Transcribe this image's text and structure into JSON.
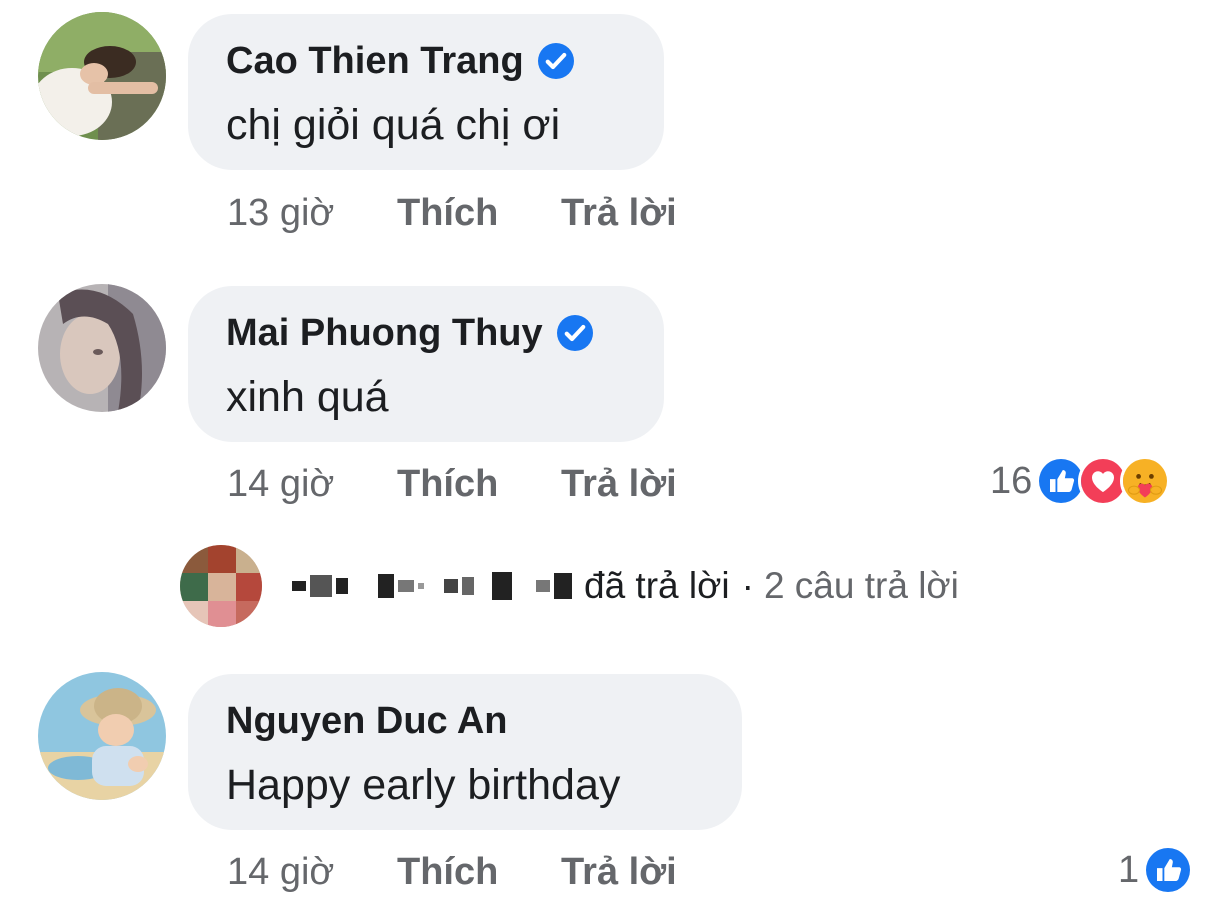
{
  "comments": [
    {
      "author": "Cao Thien Trang",
      "verified": true,
      "text": "chị giỏi quá chị ơi",
      "time": "13 giờ",
      "like_label": "Thích",
      "reply_label": "Trả lời"
    },
    {
      "author": "Mai Phuong Thuy",
      "verified": true,
      "text": "xinh quá",
      "time": "14 giờ",
      "like_label": "Thích",
      "reply_label": "Trả lời",
      "reaction_count": "16",
      "reactions": [
        "like-icon",
        "love-icon",
        "care-icon"
      ]
    },
    {
      "author": "Nguyen Duc An",
      "verified": false,
      "text": "Happy early birthday",
      "time": "14 giờ",
      "like_label": "Thích",
      "reply_label": "Trả lời",
      "reaction_count": "1",
      "reactions": [
        "like-icon"
      ]
    }
  ],
  "reply_summary": {
    "action_text": "đã trả lời",
    "separator": "·",
    "count_text": "2 câu trả lời"
  },
  "colors": {
    "bubble": "#eff1f4",
    "meta_text": "#65676b",
    "facebook_blue": "#1877f2",
    "love_red": "#f33e58",
    "care_yellow": "#f7b125"
  }
}
